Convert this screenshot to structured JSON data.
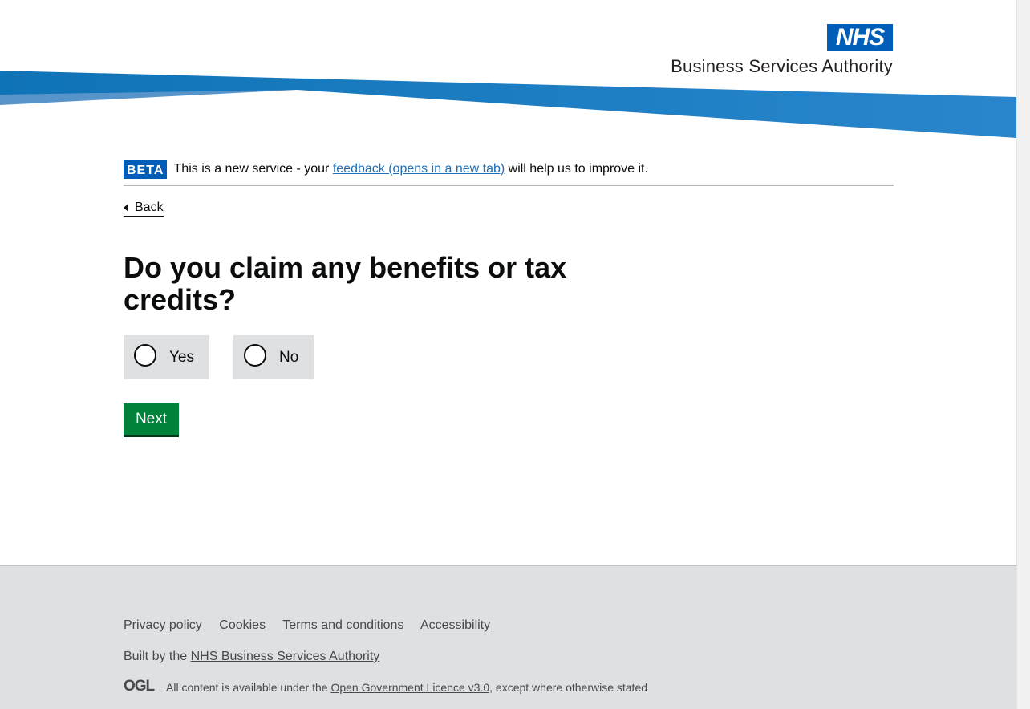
{
  "header": {
    "logo_text": "NHS",
    "org_name": "Business Services Authority",
    "brand_color": "#005eb8",
    "swoosh_light": "#5694ca",
    "swoosh_dark": "#1d70b8"
  },
  "beta_banner": {
    "tag": "BETA",
    "text_before": "This is a new service - your",
    "link_text": "feedback (opens in a new tab)",
    "text_after": "will help us to improve it."
  },
  "back_link": {
    "label": "Back"
  },
  "question": {
    "heading": "Do you claim any benefits or tax credits?"
  },
  "radios": {
    "options": [
      {
        "label": "Yes",
        "selected": false
      },
      {
        "label": "No",
        "selected": false
      }
    ]
  },
  "next_button": {
    "label": "Next",
    "color": "#00823b"
  },
  "footer": {
    "links": [
      "Privacy policy",
      "Cookies",
      "Terms and conditions",
      "Accessibility"
    ],
    "built_by_prefix": "Built by the",
    "built_by_link": "NHS Business Services Authority",
    "ogl_logo": "OGL",
    "licence_prefix": "All content is available under the",
    "licence_link": "Open Government Licence v3.0",
    "licence_suffix": ", except where otherwise stated"
  }
}
